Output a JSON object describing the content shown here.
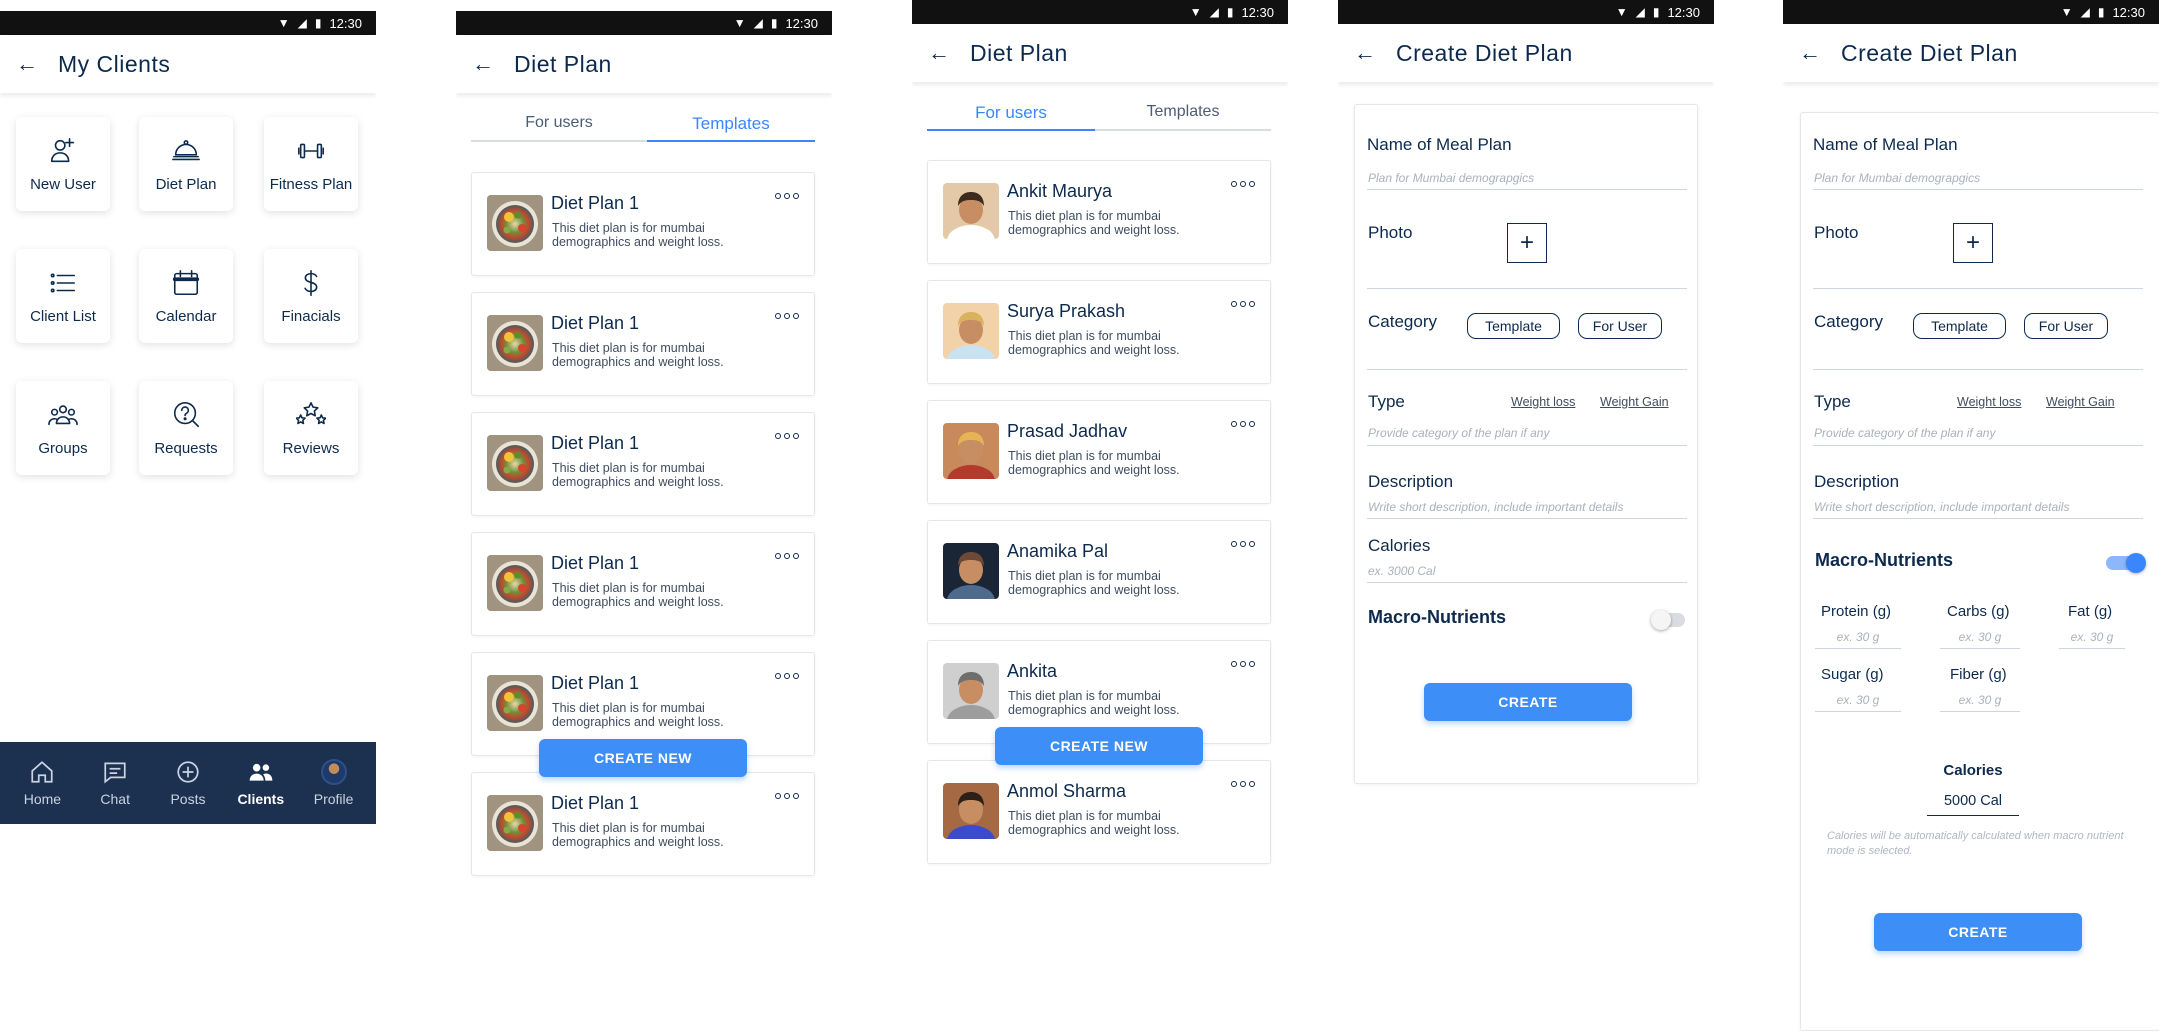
{
  "status": {
    "time": "12:30"
  },
  "clients_screen": {
    "title": "My Clients",
    "tiles": [
      {
        "label": "New User",
        "icon": "add-user-icon"
      },
      {
        "label": "Diet Plan",
        "icon": "cloche-icon"
      },
      {
        "label": "Fitness Plan",
        "icon": "dumbbell-icon"
      },
      {
        "label": "Client List",
        "icon": "list-icon"
      },
      {
        "label": "Calendar",
        "icon": "calendar-icon"
      },
      {
        "label": "Finacials",
        "icon": "dollar-icon"
      },
      {
        "label": "Groups",
        "icon": "group-icon"
      },
      {
        "label": "Requests",
        "icon": "question-icon"
      },
      {
        "label": "Reviews",
        "icon": "stars-icon"
      }
    ],
    "nav": [
      {
        "label": "Home",
        "icon": "home-icon"
      },
      {
        "label": "Chat",
        "icon": "chat-icon"
      },
      {
        "label": "Posts",
        "icon": "posts-icon"
      },
      {
        "label": "Clients",
        "icon": "clients-icon",
        "active": true
      },
      {
        "label": "Profile",
        "icon": "profile-avatar"
      }
    ]
  },
  "templates_screen": {
    "title": "Diet Plan",
    "tabs": [
      "For users",
      "Templates"
    ],
    "active_tab": "Templates",
    "cards": [
      {
        "title": "Diet Plan 1",
        "desc": "This diet plan is for mumbai demographics and weight loss."
      },
      {
        "title": "Diet Plan 1",
        "desc": "This diet plan is for mumbai demographics and weight loss."
      },
      {
        "title": "Diet Plan 1",
        "desc": "This diet plan is for mumbai demographics and weight loss."
      },
      {
        "title": "Diet Plan 1",
        "desc": "This diet plan is for mumbai demographics and weight loss."
      },
      {
        "title": "Diet Plan 1",
        "desc": "This diet plan is for mumbai demographics and weight loss."
      },
      {
        "title": "Diet Plan 1",
        "desc": "This diet plan is for mumbai demographics and weight loss."
      }
    ],
    "create_label": "CREATE NEW"
  },
  "users_screen": {
    "title": "Diet Plan",
    "tabs": [
      "For users",
      "Templates"
    ],
    "active_tab": "For users",
    "cards": [
      {
        "title": "Ankit Maurya",
        "desc": "This diet plan is for mumbai demographics and weight loss."
      },
      {
        "title": "Surya Prakash",
        "desc": "This diet plan is for mumbai demographics and weight loss."
      },
      {
        "title": "Prasad Jadhav",
        "desc": "This diet plan is for mumbai demographics and weight loss."
      },
      {
        "title": "Anamika Pal",
        "desc": "This diet plan is for mumbai demographics and weight loss."
      },
      {
        "title": "Ankita",
        "desc": "This diet plan is for mumbai demographics and weight loss."
      },
      {
        "title": "Anmol Sharma",
        "desc": "This diet plan is for mumbai demographics and weight loss."
      }
    ],
    "create_label": "CREATE NEW"
  },
  "create_screen_a": {
    "title": "Create Diet Plan",
    "name_label": "Name of Meal Plan",
    "name_placeholder": "Plan for Mumbai demograpgics",
    "photo_label": "Photo",
    "category_label": "Category",
    "category_options": [
      "Template",
      "For User"
    ],
    "type_label": "Type",
    "type_options": [
      "Weight loss",
      "Weight Gain"
    ],
    "type_placeholder": "Provide category of the plan if any",
    "description_label": "Description",
    "description_placeholder": "Write short description, include important details",
    "calories_label": "Calories",
    "calories_placeholder": "ex. 3000 Cal",
    "macro_label": "Macro-Nutrients",
    "macro_enabled": false,
    "create_label": "CREATE"
  },
  "create_screen_b": {
    "title": "Create Diet Plan",
    "name_label": "Name of Meal Plan",
    "name_placeholder": "Plan for Mumbai demograpgics",
    "photo_label": "Photo",
    "category_label": "Category",
    "category_options": [
      "Template",
      "For User"
    ],
    "type_label": "Type",
    "type_options": [
      "Weight loss",
      "Weight Gain"
    ],
    "type_placeholder": "Provide category of the plan if any",
    "description_label": "Description",
    "description_placeholder": "Write short description, include important details",
    "macro_label": "Macro-Nutrients",
    "macro_enabled": true,
    "nutrients": [
      {
        "label": "Protein (g)",
        "placeholder": "ex. 30 g"
      },
      {
        "label": "Carbs (g)",
        "placeholder": "ex. 30 g"
      },
      {
        "label": "Fat (g)",
        "placeholder": "ex. 30 g"
      },
      {
        "label": "Sugar (g)",
        "placeholder": "ex. 30 g"
      },
      {
        "label": "Fiber (g)",
        "placeholder": "ex. 30 g"
      }
    ],
    "calories_label": "Calories",
    "calories_value": "5000 Cal",
    "calories_note": "Calories will be automatically calculated when macro nutrient mode is selected.",
    "create_label": "CREATE"
  },
  "colors": {
    "accent": "#3d8ff7",
    "navy": "#0d2a4d",
    "nav_bg": "#1c3050"
  }
}
